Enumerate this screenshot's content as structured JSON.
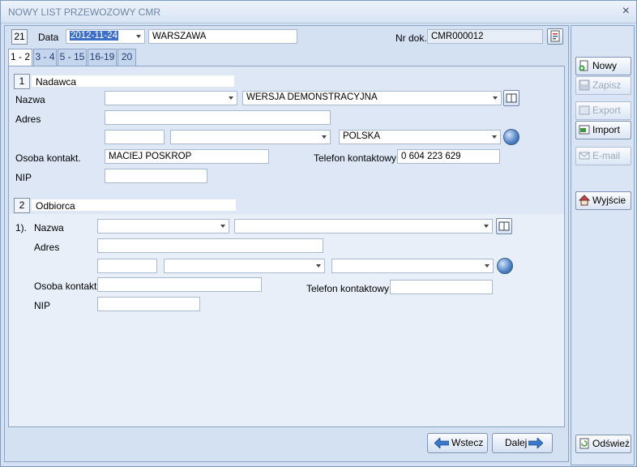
{
  "window": {
    "title": "NOWY LIST PRZEWOZOWY CMR",
    "close": "×"
  },
  "header": {
    "doc_number_box": "21",
    "date_label": "Data",
    "date_value": "2012-11-24",
    "city_value": "WARSZAWA",
    "nr_dok_label": "Nr dok.",
    "nr_dok_value": "CMR000012"
  },
  "tabs": [
    "1 - 2",
    "3 - 4",
    "5 - 15",
    "16-19",
    "20"
  ],
  "sender": {
    "section_number": "1",
    "section_title": "Nadawca",
    "name_label": "Nazwa",
    "name_value": "WERSJA DEMONSTRACYJNA",
    "address_label": "Adres",
    "country_value": "POLSKA",
    "contact_label": "Osoba kontakt.",
    "contact_value": "MACIEJ POSKROP",
    "phone_label": "Telefon kontaktowy",
    "phone_value": "0 604 223 629",
    "nip_label": "NIP"
  },
  "receiver": {
    "section_number": "2",
    "section_title": "Odbiorca",
    "index_label": "1).",
    "name_label": "Nazwa",
    "address_label": "Adres",
    "contact_label": "Osoba kontakt.",
    "phone_label": "Telefon kontaktowy",
    "nip_label": "NIP"
  },
  "footer": {
    "back_label": "Wstecz",
    "next_label": "Dalej"
  },
  "sidebar": {
    "new": "Nowy",
    "save": "Zapisz",
    "export": "Export",
    "import": "Import",
    "email": "E-mail",
    "exit": "Wyjście",
    "refresh": "Odśwież"
  }
}
